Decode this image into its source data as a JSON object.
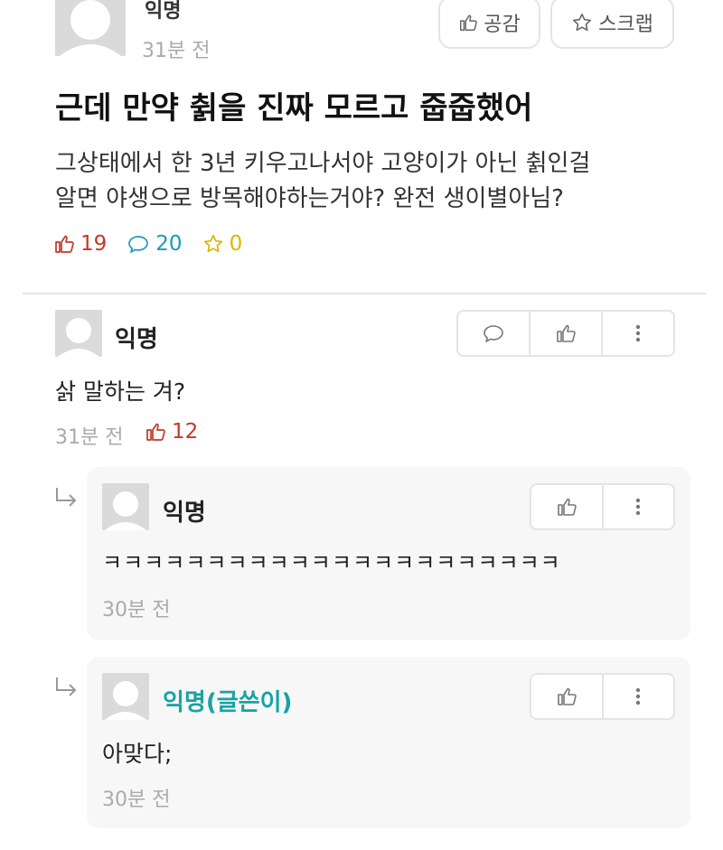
{
  "post": {
    "author": "익명",
    "time": "31분 전",
    "title": "근데 만약 췱을 진짜 모르고 줍줍했어",
    "body_line1": "그상태에서 한 3년 키우고나서야 고양이가 아닌 췱인걸",
    "body_line2": "알면 야생으로 방목해야하는거야? 완전 생이별아님?",
    "like_label": "공감",
    "scrap_label": "스크랩",
    "likes": "19",
    "comments": "20",
    "scraps": "0"
  },
  "comments": [
    {
      "author": "익명",
      "text": "삵 말하는 겨?",
      "time": "31분 전",
      "likes": "12"
    }
  ],
  "replies": [
    {
      "author": "익명",
      "text": "ㅋㅋㅋㅋㅋㅋㅋㅋㅋㅋㅋㅋㅋㅋㅋㅋㅋㅋㅋㅋㅋㅋ",
      "time": "30분 전"
    },
    {
      "author": "익명(글쓴이)",
      "text": "아맞다;",
      "time": "30분 전"
    }
  ],
  "colors": {
    "like": "#c0392b",
    "comment": "#1a9bb8",
    "scrap": "#e0b400",
    "op_name": "#17a3a3"
  }
}
